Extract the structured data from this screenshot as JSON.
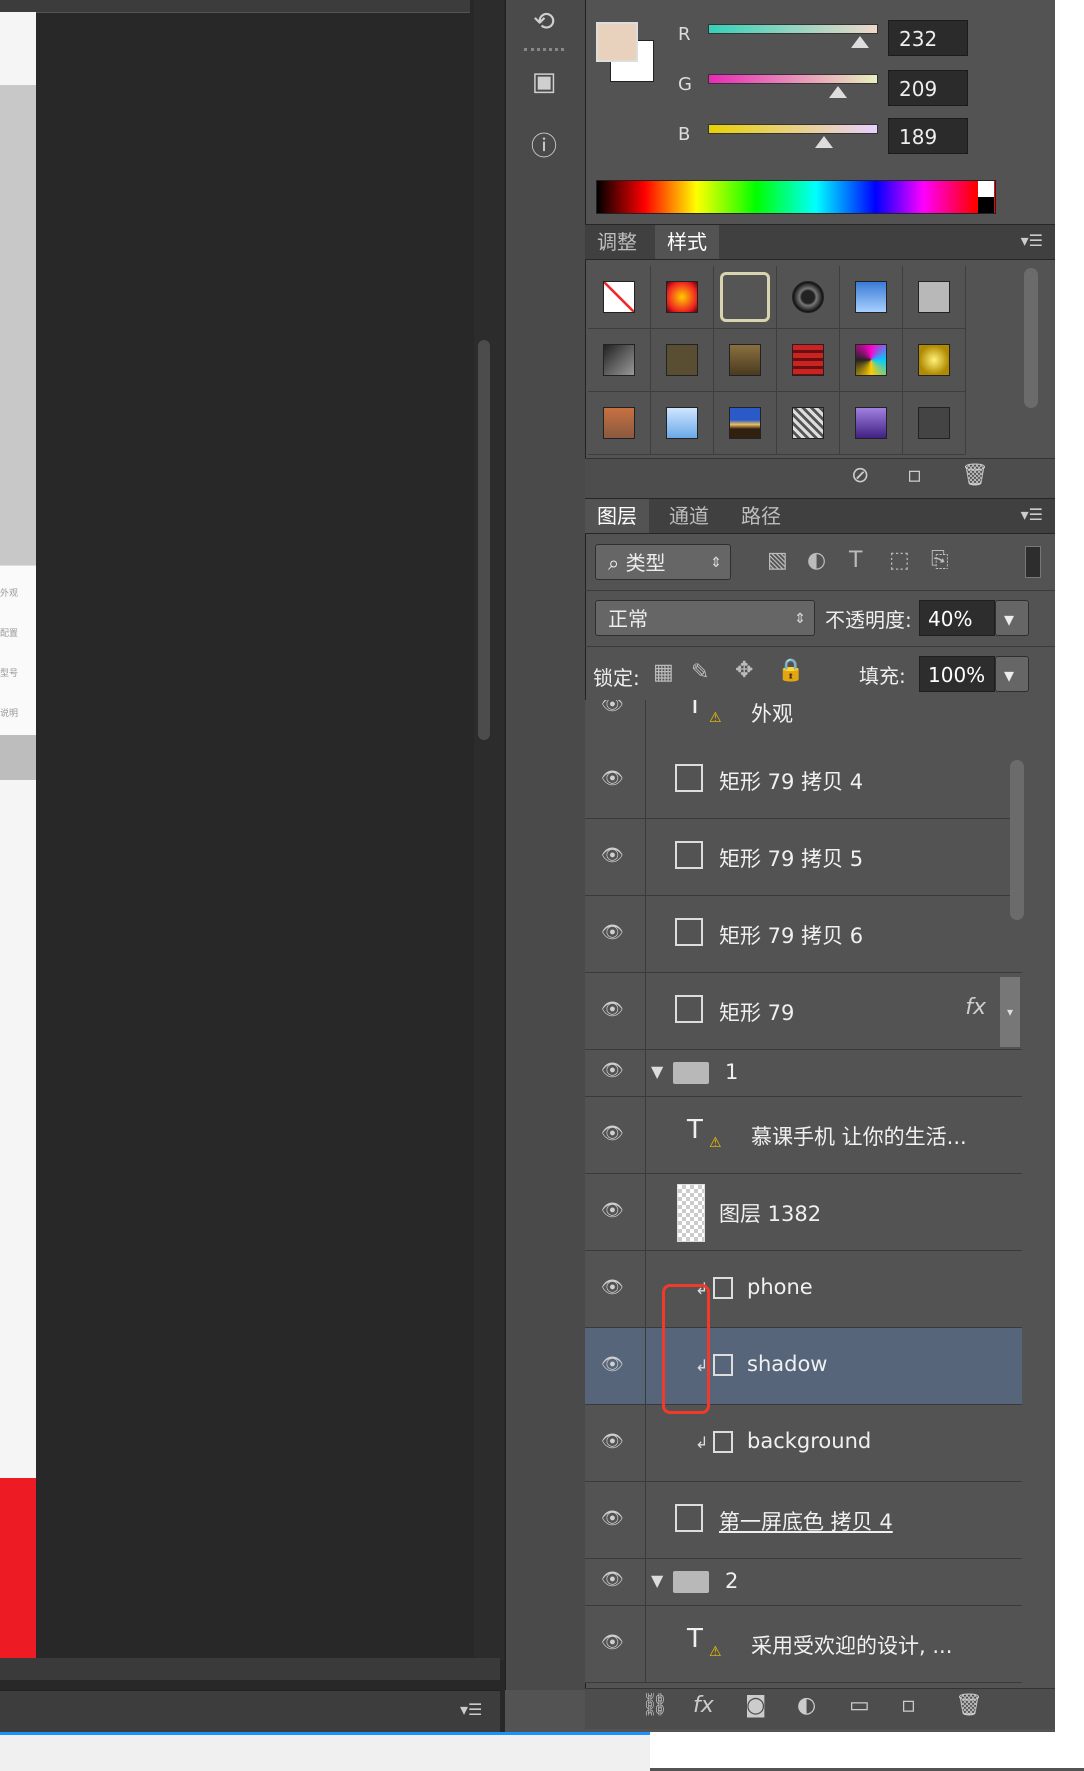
{
  "color": {
    "fg_color": "#e8d1bd",
    "channels": [
      {
        "label": "R",
        "value": "232"
      },
      {
        "label": "G",
        "value": "209"
      },
      {
        "label": "B",
        "value": "189"
      }
    ]
  },
  "styles_panel": {
    "tabs": [
      "调整",
      "样式"
    ],
    "active_tab": "样式"
  },
  "layers_panel": {
    "tabs": [
      "图层",
      "通道",
      "路径"
    ],
    "filter_label": "类型",
    "blend_mode": "正常",
    "opacity_label": "不透明度:",
    "opacity_value": "40%",
    "lock_label": "锁定:",
    "fill_label": "填充:",
    "fill_value": "100%",
    "layers": [
      {
        "name": "外观",
        "type": "text-warning"
      },
      {
        "name": "矩形 79 拷贝 4",
        "type": "shape"
      },
      {
        "name": "矩形 79 拷贝 5",
        "type": "shape"
      },
      {
        "name": "矩形 79 拷贝 6",
        "type": "shape"
      },
      {
        "name": "矩形 79",
        "type": "shape",
        "fx": "fx"
      },
      {
        "name": "1",
        "type": "group"
      },
      {
        "name": "慕课手机 让你的生活...",
        "type": "text-warning"
      },
      {
        "name": "图层 1382",
        "type": "pixel"
      },
      {
        "name": "phone",
        "type": "smart-clipped"
      },
      {
        "name": "shadow",
        "type": "smart-clipped",
        "selected": true
      },
      {
        "name": "background",
        "type": "smart-clipped"
      },
      {
        "name": "第一屏底色 拷贝 4",
        "type": "shape"
      },
      {
        "name": "2",
        "type": "group"
      },
      {
        "name": "采用受欢迎的设计, ...",
        "type": "text-warning"
      }
    ]
  },
  "canvas_doc": {
    "sidebar_labels": [
      "外观",
      "配置",
      "型号",
      "说明"
    ]
  },
  "accent": {
    "selection": "#56657a",
    "highlight_box": "#ee3b2c",
    "doc_red": "#ed1c24"
  }
}
